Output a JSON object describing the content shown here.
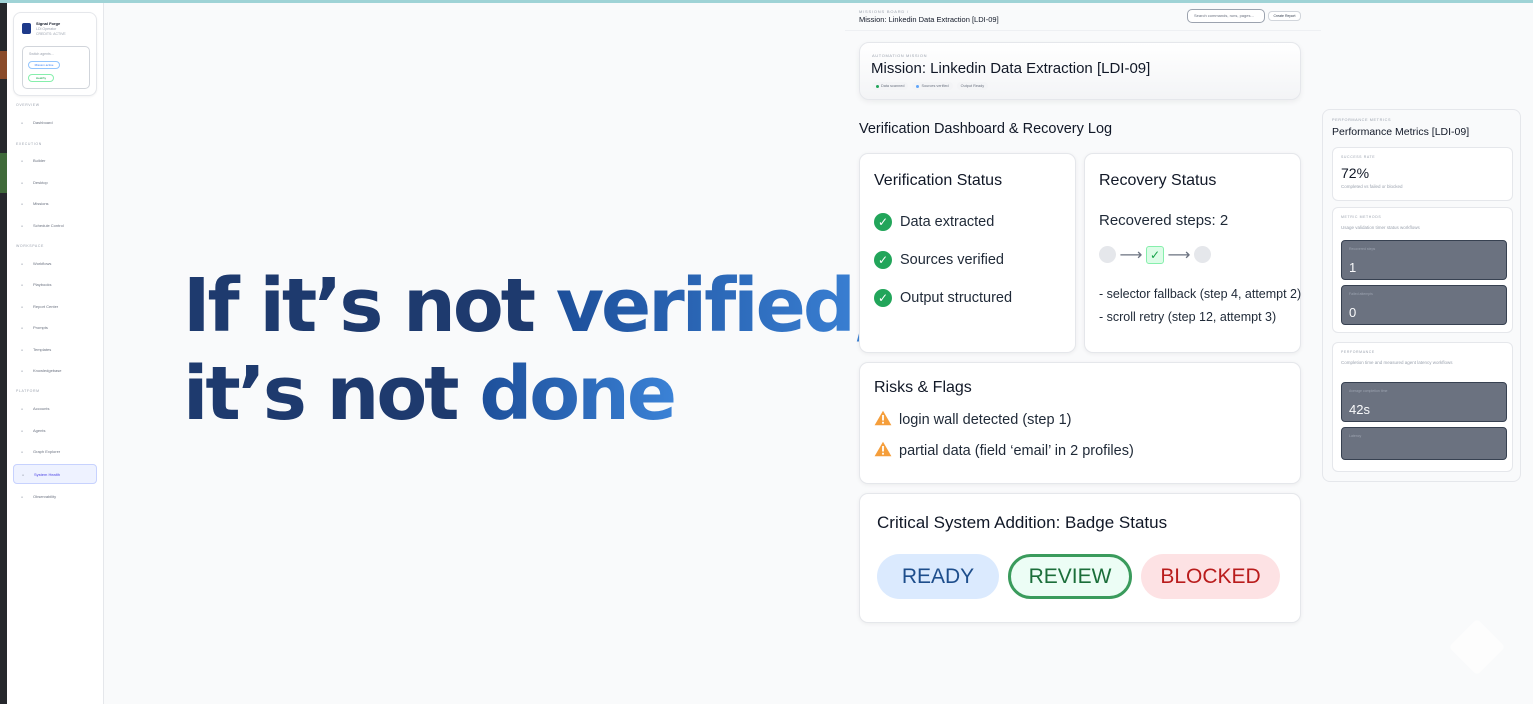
{
  "sidebar": {
    "profile": {
      "name": "Signal Forge",
      "subtitle": "LDI Operator",
      "subtitle2": "CREDITS: ACTIVE",
      "box_text": "Switch agents...",
      "pill_primary": "Mission active",
      "pill_secondary": "Healthy"
    },
    "sections": [
      {
        "title": "Overview",
        "items": [
          {
            "label": "Dashboard",
            "active": false
          }
        ]
      },
      {
        "title": "Execution",
        "items": [
          {
            "label": "Builder",
            "active": false
          },
          {
            "label": "Desktop",
            "active": false
          },
          {
            "label": "Missions",
            "active": false
          },
          {
            "label": "Schedule Control",
            "active": false
          }
        ]
      },
      {
        "title": "Workspace",
        "items": [
          {
            "label": "Workflows",
            "active": false
          },
          {
            "label": "Playbooks",
            "active": false
          },
          {
            "label": "Report Center",
            "active": false
          },
          {
            "label": "Prompts",
            "active": false
          },
          {
            "label": "Templates",
            "active": false
          },
          {
            "label": "Knowledgebase",
            "active": false
          }
        ]
      },
      {
        "title": "Platform",
        "items": [
          {
            "label": "Accounts",
            "active": false
          },
          {
            "label": "Agents",
            "active": false
          },
          {
            "label": "Graph Explorer",
            "active": false
          },
          {
            "label": "System Health",
            "active": true
          },
          {
            "label": "Observability",
            "active": false
          }
        ]
      }
    ]
  },
  "hero": {
    "line1_dark": "If it’s not ",
    "line1_accent": "verified,",
    "line2_dark": "it’s not ",
    "line2_accent": "done"
  },
  "header": {
    "breadcrumb": "MISSIONS BOARD  /",
    "title": "Mission: Linkedin Data Extraction [LDI-09]",
    "search_placeholder": "Search commands, runs, pages...",
    "button_label": "Create Report"
  },
  "mission": {
    "label": "AUTOMATION MISSION",
    "title": "Mission: Linkedin Data Extraction [LDI-09]",
    "tags": [
      {
        "label": "Data scanned",
        "dot": "#22a55a"
      },
      {
        "label": "Sources verified",
        "dot": "#60a5fa"
      },
      {
        "label": "Output Ready",
        "dot": ""
      }
    ]
  },
  "dashboard": {
    "title": "Verification Dashboard & Recovery Log",
    "verification": {
      "title": "Verification Status",
      "items": [
        "Data extracted",
        "Sources verified",
        "Output structured"
      ]
    },
    "recovery": {
      "title": "Recovery Status",
      "recovered": "Recovered steps: 2",
      "logs": [
        "- selector fallback (step 4, attempt 2)",
        "- scroll retry (step 12, attempt 3)"
      ]
    },
    "risks": {
      "title": "Risks & Flags",
      "items": [
        "login wall detected (step 1)",
        "partial data (field ‘email’ in 2 profiles)"
      ]
    },
    "badges": {
      "title": "Critical System Addition: Badge Status",
      "ready": "READY",
      "review": "REVIEW",
      "blocked": "BLOCKED"
    }
  },
  "performance": {
    "label": "PERFORMANCE METRICS",
    "title": "Performance Metrics [LDI-09]",
    "success": {
      "label": "SUCCESS RATE",
      "value": "72%",
      "sub": "Completed vs failed or blocked"
    },
    "methods": {
      "label": "METRIC METHODS",
      "desc": "Usage validation timer status workflows",
      "box1_label": "Recovered steps",
      "box1_value": "1",
      "box2_label": "Failed attempts",
      "box2_value": "0"
    },
    "perf": {
      "label": "PERFORMANCE",
      "desc": "Completion time and measured agent latency workflows",
      "box1_label": "Average completion time",
      "box1_value": "42s",
      "box2_label": "Latency",
      "box2_value": ""
    }
  },
  "colors": {
    "accent_blue": "#3b82d6",
    "success_green": "#22a55a",
    "warning_orange": "#f59e3b",
    "blocked_red": "#b91c1c"
  }
}
